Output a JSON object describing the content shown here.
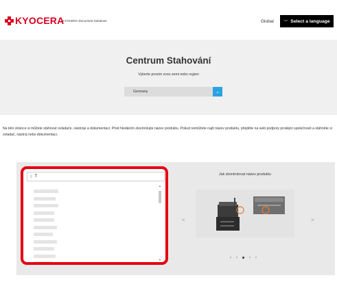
{
  "header": {
    "logo_text": "KYOCERA",
    "logo_subtitle": "KYOCERA Document Solutions",
    "global_link": "Global",
    "language_button": "Select a language"
  },
  "hero": {
    "title": "Centrum Stahování",
    "subtitle": "Vyberte prosím svou zemi nebo region",
    "region_value": "Germany"
  },
  "notice": "Na této stránce si můžete stáhnout ovladače, nástroje a dokumentaci. Před hledáním zkontrolujte název produktu. Pokud nemůžete najít název produktu, přejděte na web podpory prodejní společnosti a stáhněte si ovladač, nástroj nebo dokumentaci.",
  "search": {
    "value": "T",
    "highlight_color": "#e60012"
  },
  "slider": {
    "title": "Jak zkontrolovat název produktu",
    "active_dot": 2,
    "dot_count": 5
  },
  "colors": {
    "brand": "#d8001c",
    "accent": "#2aa3e0"
  }
}
